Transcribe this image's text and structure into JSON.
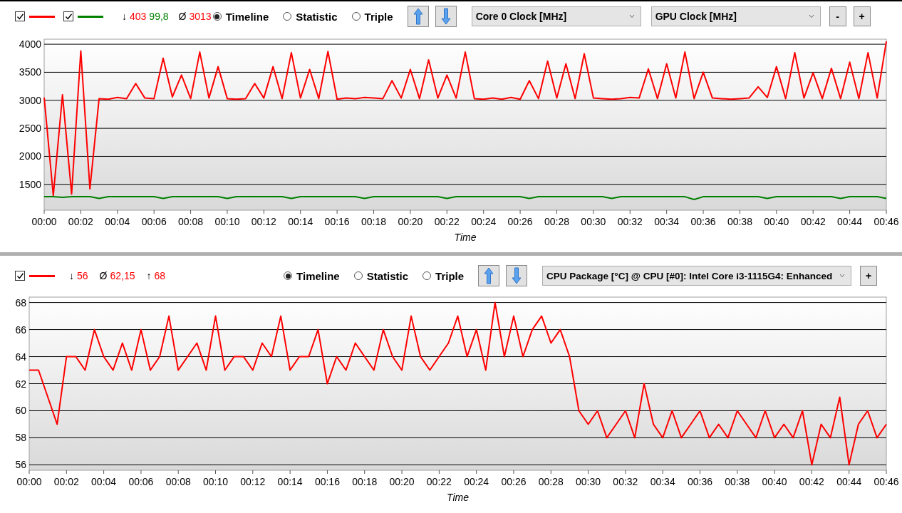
{
  "top_panel": {
    "series_toggles": [
      {
        "checked": true,
        "color": "#ff0000"
      },
      {
        "checked": true,
        "color": "#008000"
      }
    ],
    "stats": [
      {
        "symbol": "↓",
        "values": [
          {
            "text": "403",
            "color": "#ff0000"
          },
          {
            "text": "99,8",
            "color": "#008000"
          }
        ]
      },
      {
        "symbol": "Ø",
        "values": [
          {
            "text": "3013",
            "color": "#ff0000"
          }
        ]
      }
    ],
    "view_modes": [
      {
        "label": "Timeline",
        "selected": true
      },
      {
        "label": "Statistic",
        "selected": false
      },
      {
        "label": "Triple",
        "selected": false
      }
    ],
    "sensor_selects": [
      {
        "value": "Core 0 Clock [MHz]"
      },
      {
        "value": "GPU Clock [MHz]"
      }
    ],
    "zoom_buttons": [
      "-",
      "+"
    ],
    "chart_data": {
      "type": "line",
      "xlabel": "Time",
      "grid": true,
      "xlim": [
        0,
        46
      ],
      "ylim": [
        1040,
        4090
      ],
      "yticks": [
        1500,
        2000,
        2500,
        3000,
        3500,
        4000
      ],
      "x": [
        0,
        0.5,
        1,
        1.5,
        2,
        2.5,
        3,
        3.5,
        4,
        4.5,
        5,
        5.5,
        6,
        6.5,
        7,
        7.5,
        8,
        8.5,
        9,
        9.5,
        10,
        10.5,
        11,
        11.5,
        12,
        12.5,
        13,
        13.5,
        14,
        14.5,
        15,
        15.5,
        16,
        16.5,
        17,
        17.5,
        18,
        18.5,
        19,
        19.5,
        20,
        20.5,
        21,
        21.5,
        22,
        22.5,
        23,
        23.5,
        24,
        24.5,
        25,
        25.5,
        26,
        26.5,
        27,
        27.5,
        28,
        28.5,
        29,
        29.5,
        30,
        30.5,
        31,
        31.5,
        32,
        32.5,
        33,
        33.5,
        34,
        34.5,
        35,
        35.5,
        36,
        36.5,
        37,
        37.5,
        38,
        38.5,
        39,
        39.5,
        40,
        40.5,
        41,
        41.5,
        42,
        42.5,
        43,
        43.5,
        44,
        44.5,
        45,
        45.5,
        46
      ],
      "xticks": [
        {
          "value": 0,
          "label": "00:00"
        },
        {
          "value": 2,
          "label": "00:02"
        },
        {
          "value": 4,
          "label": "00:04"
        },
        {
          "value": 6,
          "label": "00:06"
        },
        {
          "value": 8,
          "label": "00:08"
        },
        {
          "value": 10,
          "label": "00:10"
        },
        {
          "value": 12,
          "label": "00:12"
        },
        {
          "value": 14,
          "label": "00:14"
        },
        {
          "value": 16,
          "label": "00:16"
        },
        {
          "value": 18,
          "label": "00:18"
        },
        {
          "value": 20,
          "label": "00:20"
        },
        {
          "value": 22,
          "label": "00:22"
        },
        {
          "value": 24,
          "label": "00:24"
        },
        {
          "value": 26,
          "label": "00:26"
        },
        {
          "value": 28,
          "label": "00:28"
        },
        {
          "value": 30,
          "label": "00:30"
        },
        {
          "value": 32,
          "label": "00:32"
        },
        {
          "value": 34,
          "label": "00:34"
        },
        {
          "value": 36,
          "label": "00:36"
        },
        {
          "value": 38,
          "label": "00:38"
        },
        {
          "value": 40,
          "label": "00:40"
        },
        {
          "value": 42,
          "label": "00:42"
        },
        {
          "value": 44,
          "label": "00:44"
        },
        {
          "value": 46,
          "label": "00:46"
        }
      ],
      "series": [
        {
          "color": "#ff0000",
          "values": [
            3050,
            1300,
            3100,
            1330,
            3880,
            1420,
            3030,
            3020,
            3050,
            3030,
            3300,
            3040,
            3030,
            3750,
            3060,
            3450,
            3030,
            3860,
            3040,
            3600,
            3030,
            3020,
            3030,
            3300,
            3040,
            3600,
            3030,
            3850,
            3040,
            3550,
            3030,
            3870,
            3020,
            3040,
            3030,
            3050,
            3040,
            3030,
            3350,
            3040,
            3550,
            3030,
            3720,
            3040,
            3450,
            3040,
            3860,
            3030,
            3020,
            3040,
            3020,
            3050,
            3020,
            3350,
            3030,
            3700,
            3040,
            3650,
            3030,
            3830,
            3040,
            3030,
            3020,
            3030,
            3050,
            3040,
            3560,
            3030,
            3650,
            3040,
            3860,
            3030,
            3500,
            3040,
            3030,
            3020,
            3030,
            3040,
            3240,
            3050,
            3600,
            3030,
            3850,
            3040,
            3490,
            3030,
            3570,
            3030,
            3680,
            3030,
            3850,
            3040,
            4050
          ]
        },
        {
          "color": "#008000",
          "values": [
            1280,
            1280,
            1270,
            1280,
            1280,
            1280,
            1250,
            1280,
            1280,
            1280,
            1280,
            1280,
            1280,
            1250,
            1280,
            1280,
            1280,
            1280,
            1280,
            1280,
            1250,
            1280,
            1280,
            1280,
            1280,
            1280,
            1280,
            1250,
            1280,
            1280,
            1280,
            1280,
            1280,
            1280,
            1280,
            1250,
            1280,
            1280,
            1280,
            1280,
            1280,
            1280,
            1280,
            1280,
            1250,
            1280,
            1280,
            1280,
            1280,
            1280,
            1280,
            1280,
            1280,
            1250,
            1280,
            1280,
            1280,
            1280,
            1280,
            1280,
            1280,
            1280,
            1250,
            1280,
            1280,
            1280,
            1280,
            1280,
            1280,
            1280,
            1280,
            1230,
            1280,
            1280,
            1280,
            1280,
            1280,
            1280,
            1280,
            1250,
            1280,
            1280,
            1280,
            1280,
            1280,
            1280,
            1280,
            1250,
            1280,
            1280,
            1280,
            1280,
            1250
          ]
        }
      ]
    }
  },
  "bottom_panel": {
    "series_toggles": [
      {
        "checked": true,
        "color": "#ff0000"
      }
    ],
    "stats": [
      {
        "symbol": "↓",
        "values": [
          {
            "text": "56",
            "color": "#ff0000"
          }
        ]
      },
      {
        "symbol": "Ø",
        "values": [
          {
            "text": "62,15",
            "color": "#ff0000"
          }
        ]
      },
      {
        "symbol": "↑",
        "values": [
          {
            "text": "68",
            "color": "#ff0000"
          }
        ]
      }
    ],
    "view_modes": [
      {
        "label": "Timeline",
        "selected": true
      },
      {
        "label": "Statistic",
        "selected": false
      },
      {
        "label": "Triple",
        "selected": false
      }
    ],
    "sensor_selects": [
      {
        "value": "CPU Package [°C] @ CPU [#0]: Intel Core i3-1115G4: Enhanced"
      }
    ],
    "zoom_buttons": [
      "+"
    ],
    "chart_data": {
      "type": "line",
      "xlabel": "Time",
      "grid": true,
      "xlim": [
        0,
        46
      ],
      "ylim": [
        55.6,
        68.4
      ],
      "yticks": [
        56,
        58,
        60,
        62,
        64,
        66,
        68
      ],
      "x": [
        0,
        0.5,
        1,
        1.5,
        2,
        2.5,
        3,
        3.5,
        4,
        4.5,
        5,
        5.5,
        6,
        6.5,
        7,
        7.5,
        8,
        8.5,
        9,
        9.5,
        10,
        10.5,
        11,
        11.5,
        12,
        12.5,
        13,
        13.5,
        14,
        14.5,
        15,
        15.5,
        16,
        16.5,
        17,
        17.5,
        18,
        18.5,
        19,
        19.5,
        20,
        20.5,
        21,
        21.5,
        22,
        22.5,
        23,
        23.5,
        24,
        24.5,
        25,
        25.5,
        26,
        26.5,
        27,
        27.5,
        28,
        28.5,
        29,
        29.5,
        30,
        30.5,
        31,
        31.5,
        32,
        32.5,
        33,
        33.5,
        34,
        34.5,
        35,
        35.5,
        36,
        36.5,
        37,
        37.5,
        38,
        38.5,
        39,
        39.5,
        40,
        40.5,
        41,
        41.5,
        42,
        42.5,
        43,
        43.5,
        44,
        44.5,
        45,
        45.5,
        46
      ],
      "xticks": [
        {
          "value": 0,
          "label": "00:00"
        },
        {
          "value": 2,
          "label": "00:02"
        },
        {
          "value": 4,
          "label": "00:04"
        },
        {
          "value": 6,
          "label": "00:06"
        },
        {
          "value": 8,
          "label": "00:08"
        },
        {
          "value": 10,
          "label": "00:10"
        },
        {
          "value": 12,
          "label": "00:12"
        },
        {
          "value": 14,
          "label": "00:14"
        },
        {
          "value": 16,
          "label": "00:16"
        },
        {
          "value": 18,
          "label": "00:18"
        },
        {
          "value": 20,
          "label": "00:20"
        },
        {
          "value": 22,
          "label": "00:22"
        },
        {
          "value": 24,
          "label": "00:24"
        },
        {
          "value": 26,
          "label": "00:26"
        },
        {
          "value": 28,
          "label": "00:28"
        },
        {
          "value": 30,
          "label": "00:30"
        },
        {
          "value": 32,
          "label": "00:32"
        },
        {
          "value": 34,
          "label": "00:34"
        },
        {
          "value": 36,
          "label": "00:36"
        },
        {
          "value": 38,
          "label": "00:38"
        },
        {
          "value": 40,
          "label": "00:40"
        },
        {
          "value": 42,
          "label": "00:42"
        },
        {
          "value": 44,
          "label": "00:44"
        },
        {
          "value": 46,
          "label": "00:46"
        }
      ],
      "series": [
        {
          "color": "#ff0000",
          "values": [
            63,
            63,
            61,
            59,
            64,
            64,
            63,
            66,
            64,
            63,
            65,
            63,
            66,
            63,
            64,
            67,
            63,
            64,
            65,
            63,
            67,
            63,
            64,
            64,
            63,
            65,
            64,
            67,
            63,
            64,
            64,
            66,
            62,
            64,
            63,
            65,
            64,
            63,
            66,
            64,
            63,
            67,
            64,
            63,
            64,
            65,
            67,
            64,
            66,
            63,
            68,
            64,
            67,
            64,
            66,
            67,
            65,
            66,
            64,
            60,
            59,
            60,
            58,
            59,
            60,
            58,
            62,
            59,
            58,
            60,
            58,
            59,
            60,
            58,
            59,
            58,
            60,
            59,
            58,
            60,
            58,
            59,
            58,
            60,
            56,
            59,
            58,
            61,
            56,
            59,
            60,
            58,
            59
          ]
        }
      ]
    }
  }
}
